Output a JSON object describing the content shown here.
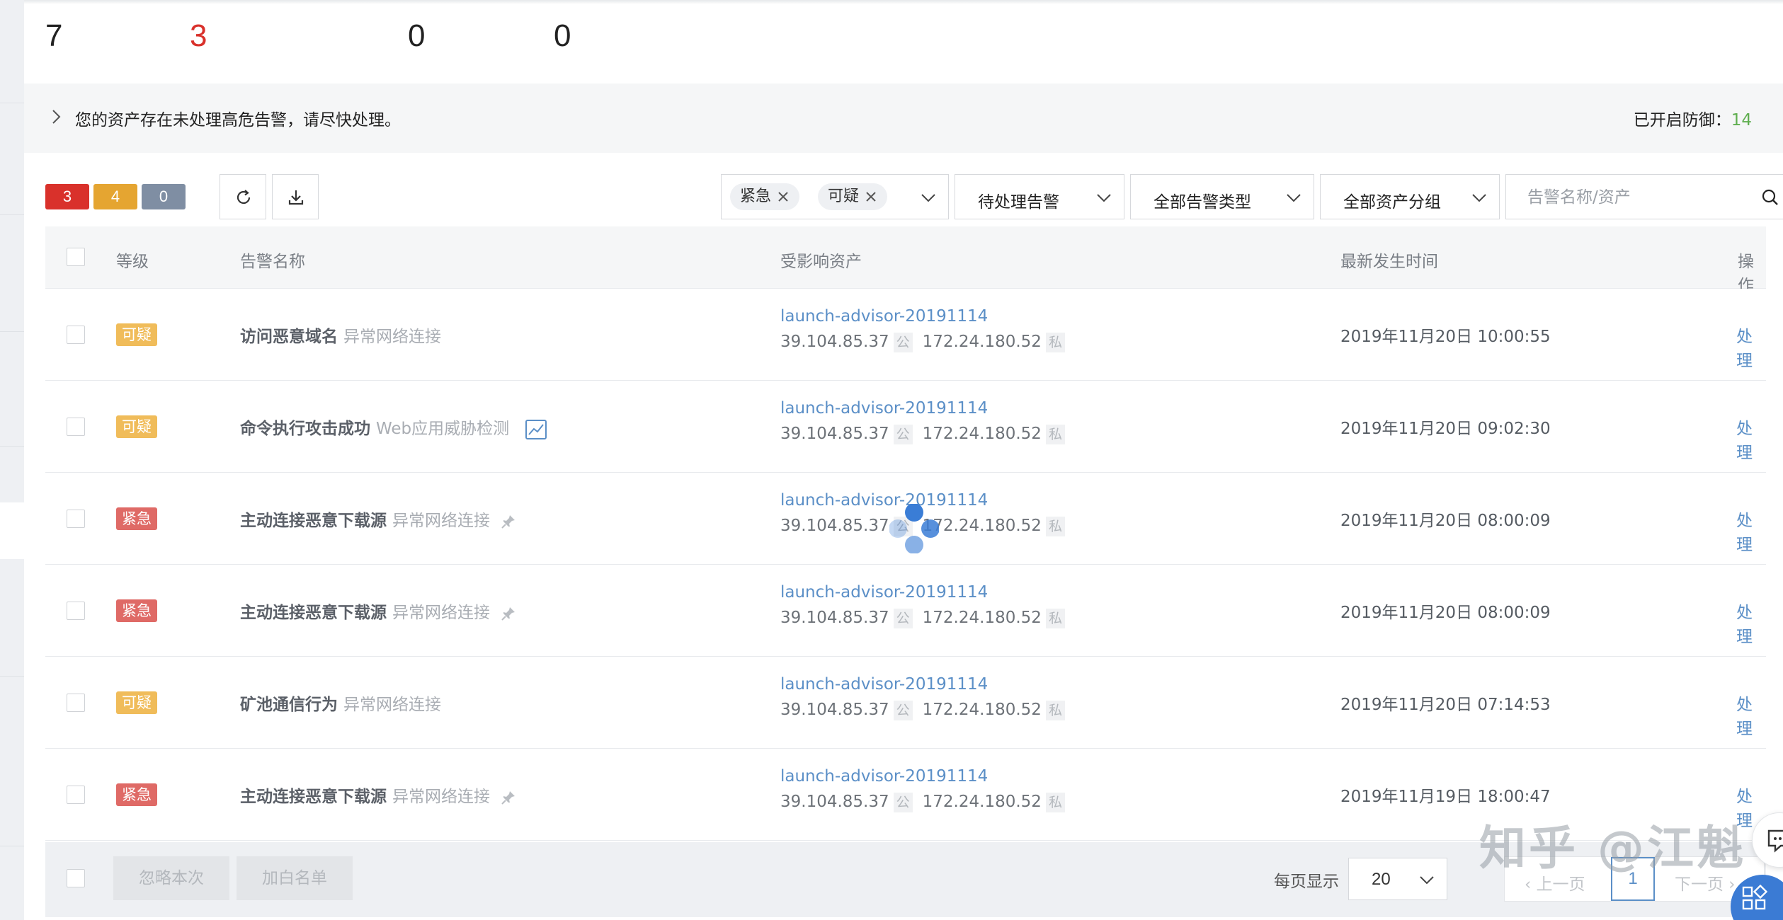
{
  "stats": {
    "values": [
      "7",
      "3",
      "0",
      "0"
    ]
  },
  "banner": {
    "message": "您的资产存在未处理高危告警，请尽快处理。",
    "defense_label": "已开启防御：",
    "defense_count": "14"
  },
  "toolbar": {
    "badges": [
      "3",
      "4",
      "0"
    ],
    "level_tags": [
      "紧急",
      "可疑"
    ],
    "status_filter": "待处理告警",
    "type_filter": "全部告警类型",
    "group_filter": "全部资产分组",
    "search_placeholder": "告警名称/资产"
  },
  "table": {
    "headers": [
      "等级",
      "告警名称",
      "受影响资产",
      "最新发生时间",
      "操作"
    ],
    "rows": [
      {
        "level": "可疑",
        "name": "访问恶意域名",
        "category": "异常网络连接",
        "host": "launch-advisor-20191114",
        "public_ip": "39.104.85.37",
        "public_tag": "公",
        "private_ip": "172.24.180.52",
        "private_tag": "私",
        "time": "2019年11月20日 10:00:55",
        "action": "处理"
      },
      {
        "level": "可疑",
        "name": "命令执行攻击成功",
        "category": "Web应用威胁检测",
        "host": "launch-advisor-20191114",
        "public_ip": "39.104.85.37",
        "public_tag": "公",
        "private_ip": "172.24.180.52",
        "private_tag": "私",
        "time": "2019年11月20日 09:02:30",
        "action": "处理"
      },
      {
        "level": "紧急",
        "name": "主动连接恶意下载源",
        "category": "异常网络连接",
        "host": "launch-advisor-20191114",
        "public_ip": "39.104.85.37",
        "public_tag": "公",
        "private_ip": "172.24.180.52",
        "private_tag": "私",
        "time": "2019年11月20日 08:00:09",
        "action": "处理"
      },
      {
        "level": "紧急",
        "name": "主动连接恶意下载源",
        "category": "异常网络连接",
        "host": "launch-advisor-20191114",
        "public_ip": "39.104.85.37",
        "public_tag": "公",
        "private_ip": "172.24.180.52",
        "private_tag": "私",
        "time": "2019年11月20日 08:00:09",
        "action": "处理"
      },
      {
        "level": "可疑",
        "name": "矿池通信行为",
        "category": "异常网络连接",
        "host": "launch-advisor-20191114",
        "public_ip": "39.104.85.37",
        "public_tag": "公",
        "private_ip": "172.24.180.52",
        "private_tag": "私",
        "time": "2019年11月20日 07:14:53",
        "action": "处理"
      },
      {
        "level": "紧急",
        "name": "主动连接恶意下载源",
        "category": "异常网络连接",
        "host": "launch-advisor-20191114",
        "public_ip": "39.104.85.37",
        "public_tag": "公",
        "private_ip": "172.24.180.52",
        "private_tag": "私",
        "time": "2019年11月19日 18:00:47",
        "action": "处理"
      }
    ]
  },
  "footer": {
    "ignore_label": "忽略本次",
    "whitelist_label": "加白名单",
    "per_page_label": "每页显示",
    "per_page_value": "20",
    "prev_label": "上一页",
    "current_page": "1",
    "next_label": "下一页"
  },
  "watermark": "知乎 @江魁",
  "colors": {
    "urgent": "#df6a66",
    "suspicious": "#f0bc5a",
    "link": "#5b8fc7",
    "danger_badge": "#d9312b",
    "warning_badge": "#e5a531",
    "neutral_badge": "#7f8ea3",
    "defense_count": "#5fae4f"
  }
}
